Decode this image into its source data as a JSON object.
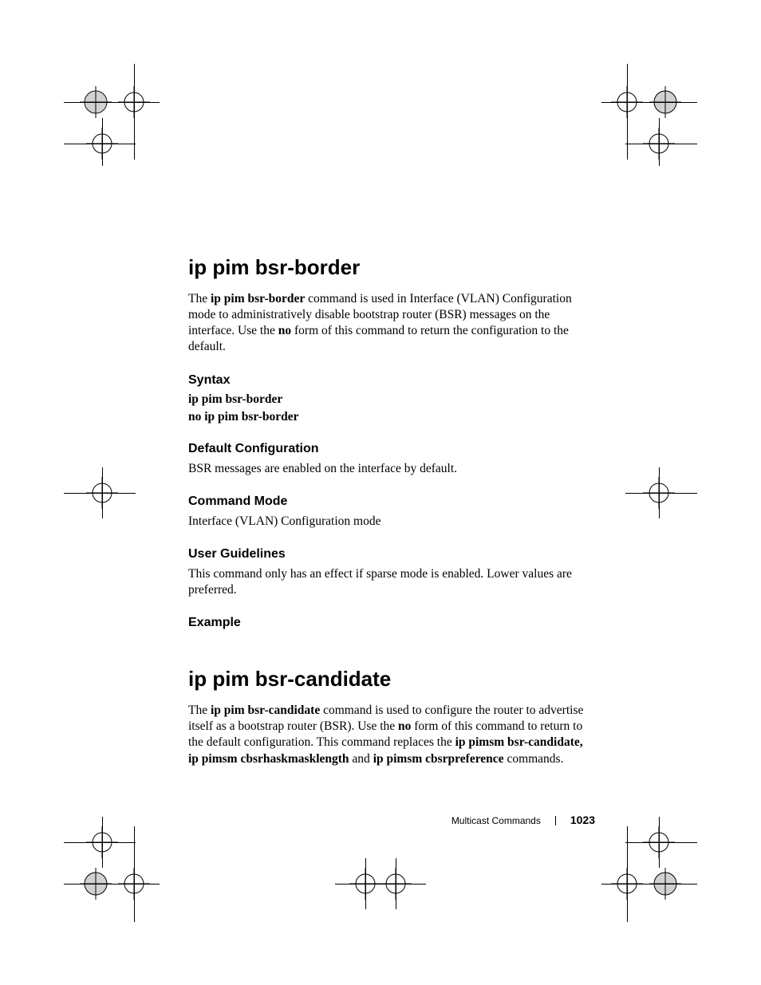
{
  "sections": [
    {
      "title": "ip pim bsr-border",
      "intro_parts": [
        "The ",
        {
          "b": "ip pim bsr-border"
        },
        " command is used in Interface (VLAN) Configuration mode to administratively disable bootstrap router (BSR) messages on the interface. Use the ",
        {
          "b": "no"
        },
        " form of this command to return the configuration to the default."
      ],
      "syntax_heading": "Syntax",
      "syntax_lines": [
        "ip pim bsr-border",
        "no ip pim bsr-border"
      ],
      "default_heading": "Default Configuration",
      "default_text": "BSR messages are enabled on the interface by default.",
      "mode_heading": "Command Mode",
      "mode_text": "Interface (VLAN) Configuration mode",
      "guidelines_heading": "User Guidelines",
      "guidelines_text": "This command only has an effect if sparse mode is enabled. Lower values are preferred.",
      "example_heading": "Example"
    },
    {
      "title": "ip pim bsr-candidate",
      "intro_parts": [
        "The ",
        {
          "b": "ip pim bsr-candidate"
        },
        " command is used to configure the router to advertise itself as a bootstrap router (BSR). Use the ",
        {
          "b": "no"
        },
        " form of this command to return to the default configuration. This command replaces the ",
        {
          "b": "ip pimsm bsr-candidate, ip pimsm cbsrhaskmasklength"
        },
        " and ",
        {
          "b": "ip pimsm cbsrpreference"
        },
        " commands."
      ]
    }
  ],
  "footer": {
    "chapter": "Multicast Commands",
    "page": "1023"
  }
}
